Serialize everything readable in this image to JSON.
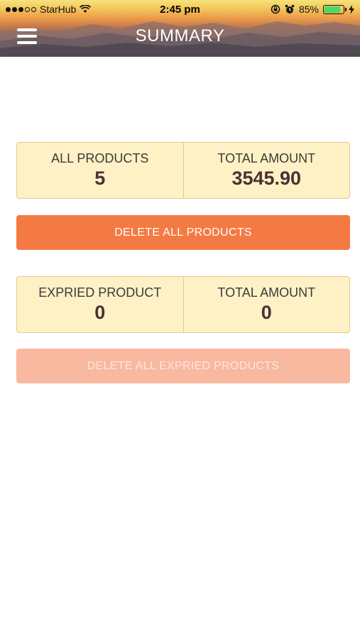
{
  "status_bar": {
    "carrier": "StarHub",
    "time": "2:45 pm",
    "battery": "85%",
    "battery_level": 0.85
  },
  "header": {
    "title": "SUMMARY"
  },
  "all_products_panel": {
    "count_label": "ALL PRODUCTS",
    "count_value": "5",
    "amount_label": "TOTAL AMOUNT",
    "amount_value": "3545.90"
  },
  "delete_all_button": {
    "label": "DELETE ALL PRODUCTS"
  },
  "expired_panel": {
    "count_label": "EXPRIED PRODUCT",
    "count_value": "0",
    "amount_label": "TOTAL AMOUNT",
    "amount_value": "0"
  },
  "delete_expired_button": {
    "label": "DELETE ALL EXPRIED PRODUCTS"
  },
  "colors": {
    "accent": "#f47a43",
    "accent_disabled": "#f9b8a0",
    "panel_bg": "#fdf1c5",
    "panel_border": "#e6c98c",
    "value_text": "#4b3035"
  }
}
